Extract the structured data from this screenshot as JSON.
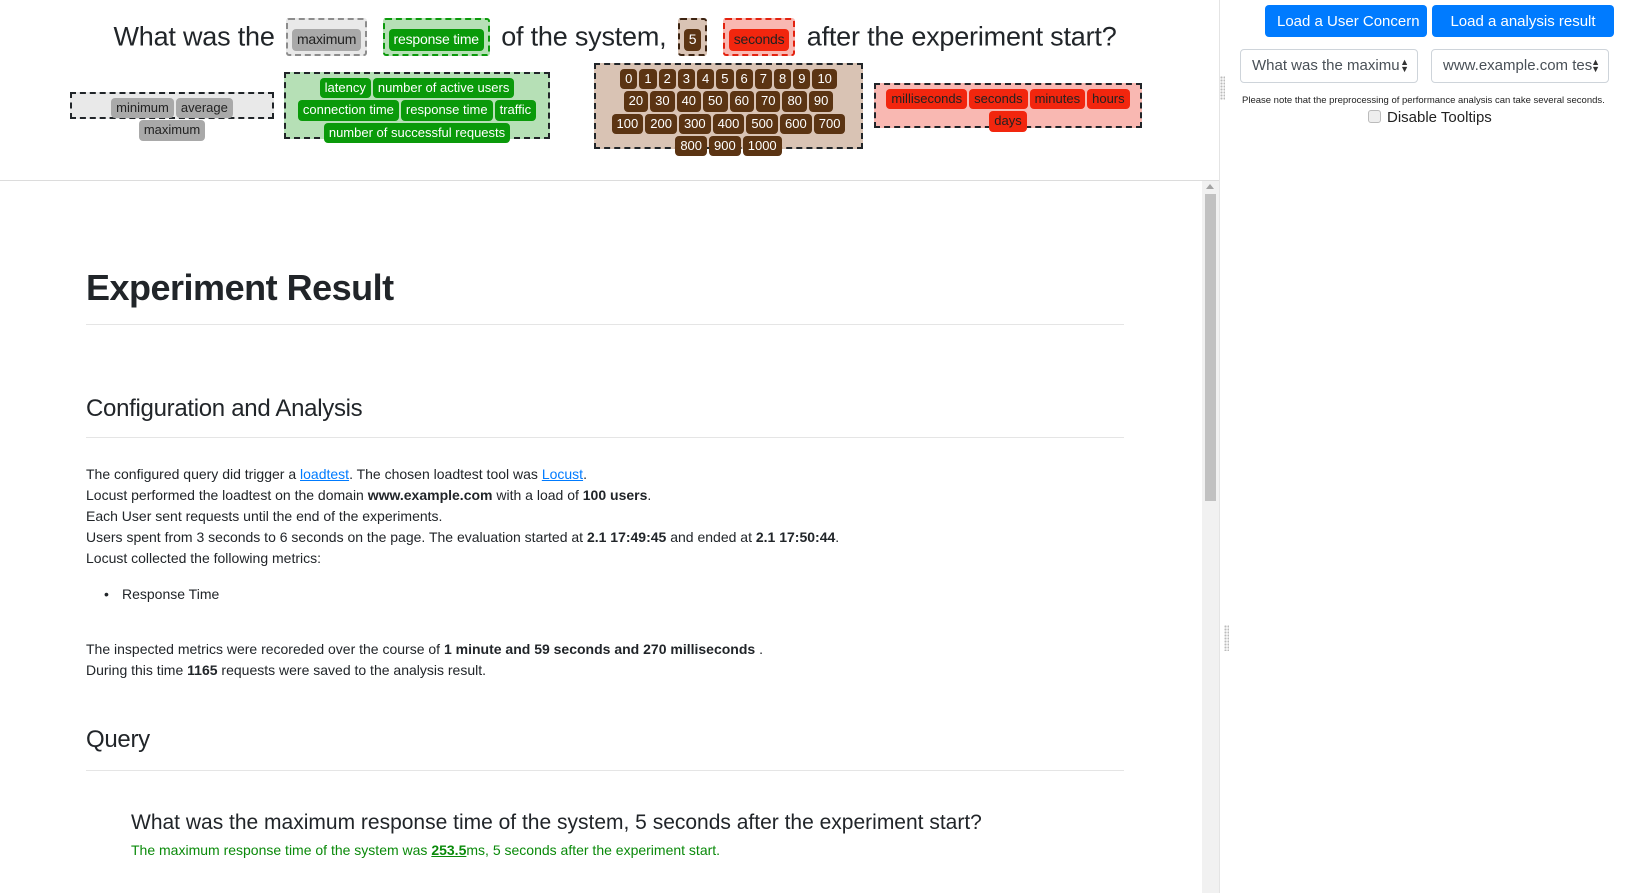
{
  "question": {
    "w1": "What was the",
    "agg": "maximum",
    "metric": "response time",
    "w2": "of the system,",
    "num": "5",
    "unit": "seconds",
    "w3": "after the experiment start?"
  },
  "pools": {
    "aggregations": [
      "minimum",
      "average",
      "maximum"
    ],
    "metrics_row1": [
      "latency",
      "number of active users"
    ],
    "metrics_row2": [
      "connection time",
      "response time",
      "traffic"
    ],
    "metrics_row3": [
      "number of successful requests"
    ],
    "numbers_row1": [
      "0",
      "1",
      "2",
      "3",
      "4",
      "5",
      "6",
      "7",
      "8",
      "9",
      "10"
    ],
    "numbers_row2": [
      "20",
      "30",
      "40",
      "50",
      "60",
      "70",
      "80",
      "90"
    ],
    "numbers_row3": [
      "100",
      "200",
      "300",
      "400",
      "500",
      "600",
      "700"
    ],
    "numbers_row4": [
      "800",
      "900",
      "1000"
    ],
    "units_row1": [
      "milliseconds",
      "seconds",
      "minutes",
      "hours"
    ],
    "units_row2": [
      "days"
    ]
  },
  "panel": {
    "load_concern": "Load a User Concern",
    "load_result": "Load a analysis result",
    "query_select": "What was the maximu",
    "domain_select": "www.example.com tes",
    "note": "Please note that the preprocessing of performance analysis can take several seconds.",
    "disable_tooltips": "Disable Tooltips"
  },
  "report": {
    "title": "Experiment Result",
    "config_heading": "Configuration and Analysis",
    "l1_a": "The configured query did trigger a ",
    "l1_link1": "loadtest",
    "l1_b": ". The chosen loadtest tool was ",
    "l1_link2": "Locust",
    "l1_c": ".",
    "l2_a": "Locust performed the loadtest on the domain ",
    "l2_domain": "www.example.com",
    "l2_b": " with a load of ",
    "l2_users": "100 users",
    "l2_c": ".",
    "l3": "Each User sent requests until the end of the experiments.",
    "l4_a": "Users spent from 3 seconds to 6 seconds on the page. The evaluation started at ",
    "l4_start": "2.1 17:49:45",
    "l4_b": " and ended at ",
    "l4_end": "2.1 17:50:44",
    "l4_c": ".",
    "l5": "Locust collected the following metrics:",
    "metric_item": "Response Time",
    "l6_a": "The inspected metrics were recoreded over the course of ",
    "l6_duration": "1 minute and 59 seconds and 270 milliseconds",
    "l6_b": " .",
    "l7_a": "During this time ",
    "l7_count": "1165",
    "l7_b": " requests were saved to the analysis result.",
    "query_heading": "Query",
    "answer_question": "What was the maximum response time of the system, 5 seconds after the experiment start?",
    "answer_a": "The maximum response time of the system was ",
    "answer_value": "253.5",
    "answer_b": "ms, 5 seconds after the experiment start."
  }
}
